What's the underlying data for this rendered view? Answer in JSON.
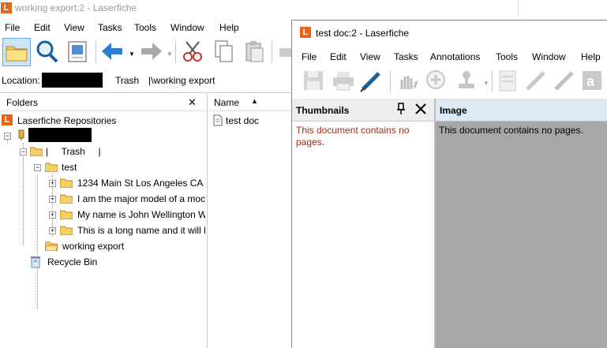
{
  "main": {
    "title": "working export:2 - Laserfiche",
    "menu": [
      "File",
      "Edit",
      "View",
      "Tasks",
      "Tools",
      "Window",
      "Help"
    ],
    "location_label": "Location:",
    "location_path_trash": "Trash",
    "location_path_rest": "|\\working export",
    "folders_title": "Folders",
    "close_glyph": "✕",
    "tree": {
      "root": "Laserfiche Repositories",
      "trash_node": "|     Trash     |",
      "test_node": "test",
      "children": [
        "1234 Main St Los Angeles CA",
        "I am the major model of a moc",
        "My name is John Wellington W",
        "This is a long name and it will h"
      ],
      "working_export": "working export",
      "recycle_bin": "Recycle Bin"
    },
    "list_header_name": "Name",
    "list_items": [
      "test doc"
    ]
  },
  "doc": {
    "title": "test doc:2 - Laserfiche",
    "menu": [
      "File",
      "Edit",
      "View",
      "Tasks",
      "Annotations",
      "Tools",
      "Window",
      "Help"
    ],
    "thumbnails_title": "Thumbnails",
    "image_title": "Image",
    "thumb_message": "This document contains no pages.",
    "image_message": "This document contains no pages."
  },
  "colors": {
    "logo": "#e8641b",
    "accent_selected": "#cce4f7",
    "thumb_text": "#a0301c",
    "image_bg": "#a7a7a7",
    "image_header": "#dce8f3"
  },
  "icons": [
    "folder-icon",
    "search-icon",
    "view-icon",
    "back-arrow-icon",
    "forward-arrow-icon",
    "cut-icon",
    "copy-icon",
    "paste-icon",
    "save-icon",
    "print-icon",
    "pen-icon",
    "hand-icon",
    "zoom-in-icon",
    "stamp-icon",
    "highlight-icon",
    "text-icon",
    "pin-icon"
  ]
}
